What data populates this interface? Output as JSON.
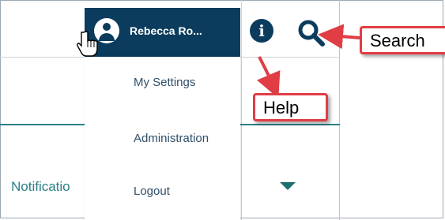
{
  "header": {
    "user_name": "Rebecca Ro...",
    "info_icon": "info-icon",
    "search_icon": "search-icon"
  },
  "user_menu": {
    "items": [
      {
        "label": "My Settings"
      },
      {
        "label": "Administration"
      },
      {
        "label": "Logout"
      }
    ]
  },
  "page": {
    "notifications_label": "Notificatio"
  },
  "callouts": {
    "search": "Search",
    "help": "Help"
  },
  "colors": {
    "header_bg": "#0b3c5d",
    "accent_teal": "#2a7f86",
    "callout_red": "#e03d45"
  }
}
